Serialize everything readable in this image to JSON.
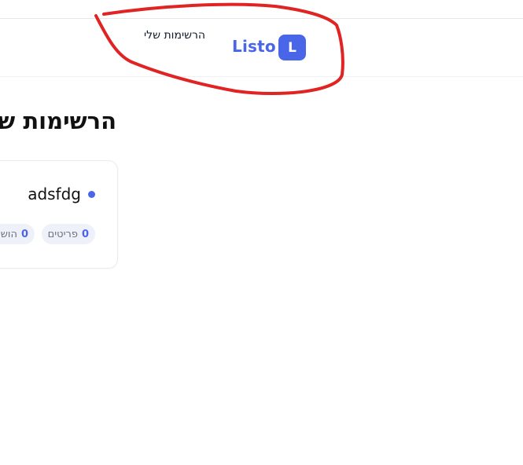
{
  "header": {
    "logo_letter": "L",
    "brand": "Listo",
    "nav_my_lists": "הרשימות שלי"
  },
  "main": {
    "title": "הרשימות ש",
    "lists": [
      {
        "name": "adsfdg",
        "dot_color": "#4a66e8",
        "items_count": "0",
        "items_label": "פריטים",
        "done_count": "0",
        "done_label": "הוש"
      }
    ]
  },
  "annotation": {
    "color": "#e02424"
  },
  "colors": {
    "accent": "#4a66e8",
    "pill_bg": "#eef1fa"
  }
}
